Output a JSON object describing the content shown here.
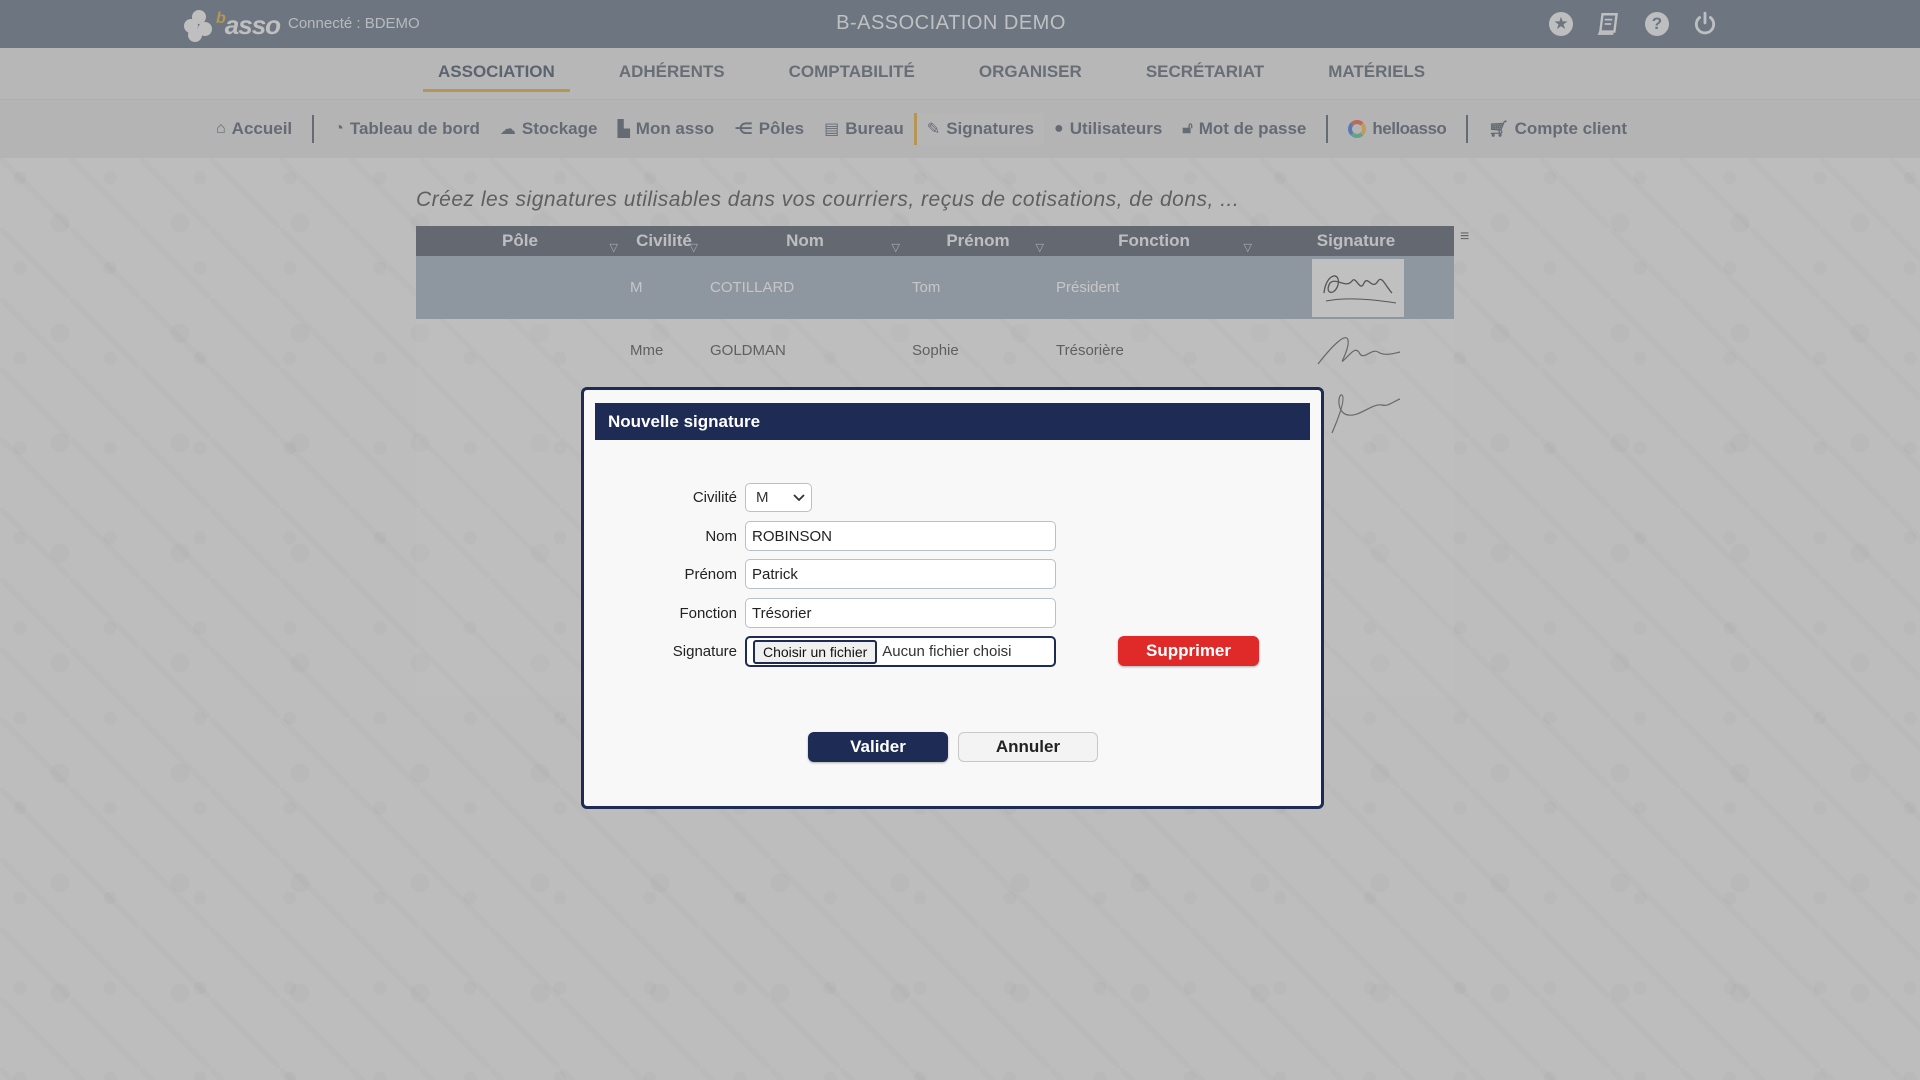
{
  "header": {
    "logo_text": "asso",
    "logo_prefix": "b",
    "connected_label": "Connecté : BDEMO",
    "app_title": "B-ASSOCIATION DEMO",
    "icons": [
      "star-icon",
      "book-icon",
      "help-icon",
      "power-icon"
    ]
  },
  "main_nav": {
    "items": [
      {
        "label": "ASSOCIATION",
        "active": true
      },
      {
        "label": "ADHÉRENTS"
      },
      {
        "label": "COMPTABILITÉ"
      },
      {
        "label": "ORGANISER"
      },
      {
        "label": "SECRÉTARIAT"
      },
      {
        "label": "MATÉRIELS"
      }
    ]
  },
  "sub_nav": {
    "items": [
      {
        "label": "Accueil",
        "icon": "home-icon"
      },
      {
        "label": "Tableau de bord",
        "icon": "dashboard-icon"
      },
      {
        "label": "Stockage",
        "icon": "cloud-icon"
      },
      {
        "label": "Mon asso",
        "icon": "building-icon"
      },
      {
        "label": "Pôles",
        "icon": "share-icon"
      },
      {
        "label": "Bureau",
        "icon": "briefcase-icon"
      },
      {
        "label": "Signatures",
        "icon": "brush-icon",
        "active": true
      },
      {
        "label": "Utilisateurs",
        "icon": "user-icon"
      },
      {
        "label": "Mot de passe",
        "icon": "lock-icon"
      },
      {
        "label": "helloasso",
        "icon": "helloasso-icon"
      },
      {
        "label": "Compte client",
        "icon": "cart-icon"
      }
    ]
  },
  "content": {
    "intro": "Créez les signatures utilisables dans vos courriers, reçus de cotisations, de dons, ...",
    "grid": {
      "columns": [
        "Pôle",
        "Civilité",
        "Nom",
        "Prénom",
        "Fonction",
        "Signature"
      ],
      "rows": [
        {
          "pole": "",
          "civilite": "M",
          "nom": "COTILLARD",
          "prenom": "Tom",
          "fonction": "Président"
        },
        {
          "pole": "",
          "civilite": "Mme",
          "nom": "GOLDMAN",
          "prenom": "Sophie",
          "fonction": "Trésorière"
        }
      ]
    }
  },
  "dialog": {
    "title": "Nouvelle signature",
    "civilite_label": "Civilité",
    "civilite_value": "M",
    "nom_label": "Nom",
    "nom_value": "ROBINSON",
    "prenom_label": "Prénom",
    "prenom_value": "Patrick",
    "fonction_label": "Fonction",
    "fonction_value": "Trésorier",
    "signature_label": "Signature",
    "file_button": "Choisir un fichier",
    "file_status": "Aucun fichier choisi",
    "delete_button": "Supprimer",
    "validate_button": "Valider",
    "cancel_button": "Annuler"
  },
  "colors": {
    "topbar": "#5c6c80",
    "accent": "#e0a92e",
    "dialog_navy": "#1d2b55",
    "danger": "#e02a2a"
  }
}
